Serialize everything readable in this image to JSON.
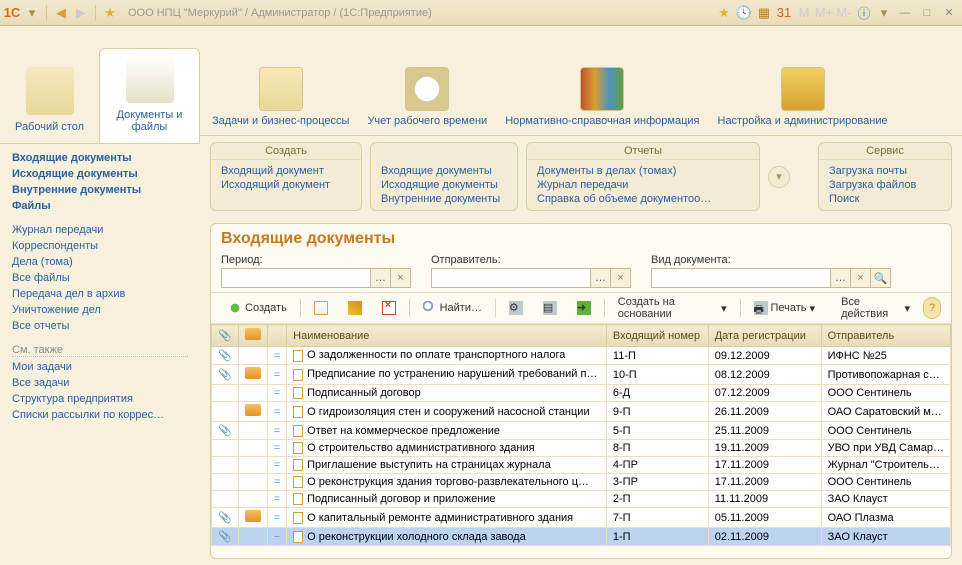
{
  "titlebar": {
    "title": "ООО НПЦ \"Меркурий\" / Администратор /  (1С:Предприятие)"
  },
  "bigtabs": [
    {
      "label": "Рабочий стол"
    },
    {
      "label": "Документы и файлы"
    }
  ],
  "sidelinks_main": [
    "Входящие документы",
    "Исходящие документы",
    "Внутренние документы",
    "Файлы"
  ],
  "sidelinks_more": [
    "Журнал передачи",
    "Корреспонденты",
    "Дела (тома)",
    "Все файлы",
    "Передача дел в архив",
    "Уничтожение дел",
    "Все отчеты"
  ],
  "see_also": {
    "header": "См. также",
    "items": [
      "Мои задачи",
      "Все задачи",
      "Структура предприятия",
      "Списки рассылки по коррес…"
    ]
  },
  "sections": [
    "Задачи и бизнес-процессы",
    "Учет рабочего времени",
    "Нормативно-справочная информация",
    "Настройка и администрирование"
  ],
  "panels": {
    "create": {
      "title": "Создать",
      "items": [
        "Входящий документ",
        "Исходящий документ"
      ]
    },
    "reports": {
      "title": "Отчеты",
      "cols": [
        [
          "Входящие документы",
          "Исходящие документы",
          "Внутренние документы"
        ],
        [
          "Документы в делах (томах)",
          "Журнал передачи",
          "Справка об объеме документоо…"
        ]
      ]
    },
    "service": {
      "title": "Сервис",
      "items": [
        "Загрузка почты",
        "Загрузка файлов",
        "Поиск"
      ]
    }
  },
  "main": {
    "title": "Входящие документы",
    "filters": {
      "period": "Период:",
      "sender": "Отправитель:",
      "doctype": "Вид документа:"
    },
    "toolbar": {
      "create": "Создать",
      "find": "Найти…",
      "base": "Создать на основании",
      "print": "Печать",
      "all": "Все действия"
    },
    "columns": {
      "c0": "",
      "c1": "",
      "c2": "",
      "name": "Наименование",
      "num": "Входящий номер",
      "date": "Дата регистрации",
      "sender": "Отправитель"
    },
    "rows": [
      {
        "clip": "📎",
        "ppl": false,
        "m": "=",
        "name": "О задолженности по оплате транспортного налога",
        "num": "11-П",
        "date": "09.12.2009",
        "sender": "ИФНС №25"
      },
      {
        "clip": "📎",
        "ppl": true,
        "m": "=",
        "name": "Предписание по устранению нарушений требований п…",
        "num": "10-П",
        "date": "08.12.2009",
        "sender": "Противопожарная с…"
      },
      {
        "clip": "",
        "ppl": false,
        "m": "=",
        "name": "Подписанный договор",
        "num": "6-Д",
        "date": "07.12.2009",
        "sender": "ООО Сентинель"
      },
      {
        "clip": "",
        "ppl": true,
        "m": "=",
        "name": "О гидроизоляция стен и сооружений насосной станции",
        "num": "9-П",
        "date": "26.11.2009",
        "sender": "ОАО Саратовский м…"
      },
      {
        "clip": "📎",
        "ppl": false,
        "m": "=",
        "name": "Ответ на коммерческое предложение",
        "num": "5-П",
        "date": "25.11.2009",
        "sender": "ООО Сентинель"
      },
      {
        "clip": "",
        "ppl": false,
        "m": "=",
        "name": "О строительство административного здания",
        "num": "8-П",
        "date": "19.11.2009",
        "sender": "УВО при УВД Самар…"
      },
      {
        "clip": "",
        "ppl": false,
        "m": "=",
        "name": "Приглашение выступить на страницах журнала",
        "num": "4-ПР",
        "date": "17.11.2009",
        "sender": "Журнал \"Строитель…"
      },
      {
        "clip": "",
        "ppl": false,
        "m": "=",
        "name": "О реконструкция здания торгово-развлекательного ц…",
        "num": "3-ПР",
        "date": "17.11.2009",
        "sender": "ООО Сентинель"
      },
      {
        "clip": "",
        "ppl": false,
        "m": "=",
        "name": "Подписанный договор и приложение",
        "num": "2-П",
        "date": "11.11.2009",
        "sender": "ЗАО Клауст"
      },
      {
        "clip": "📎",
        "ppl": true,
        "m": "=",
        "name": "О капитальный ремонте административного здания",
        "num": "7-П",
        "date": "05.11.2009",
        "sender": "ОАО Плазма"
      },
      {
        "clip": "📎",
        "ppl": false,
        "m": "−",
        "name": "О реконструкции холодного склада завода",
        "num": "1-П",
        "date": "02.11.2009",
        "sender": "ЗАО Клауст",
        "sel": true
      }
    ]
  }
}
